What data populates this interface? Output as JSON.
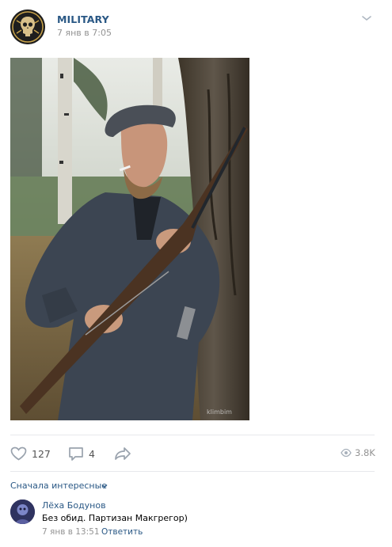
{
  "post": {
    "community_name": "MILITARY",
    "timestamp": "7 янв в 7:05",
    "photo_watermark": "klimbim",
    "likes": "127",
    "comments": "4",
    "views": "3.8K"
  },
  "comments_section": {
    "sort_label": "Сначала интересные",
    "items": [
      {
        "author": "Лёха Бодунов",
        "text": "Без обид. Партизан Макгрегор)",
        "time": "7 янв в 13:51",
        "reply_label": "Ответить"
      }
    ]
  },
  "icons": [
    "community-avatar-icon",
    "chevron-down-icon",
    "heart-icon",
    "comment-icon",
    "share-icon",
    "eye-icon"
  ],
  "colors": {
    "link": "#2a5885",
    "muted": "#939393",
    "icon": "#99a2ad"
  }
}
